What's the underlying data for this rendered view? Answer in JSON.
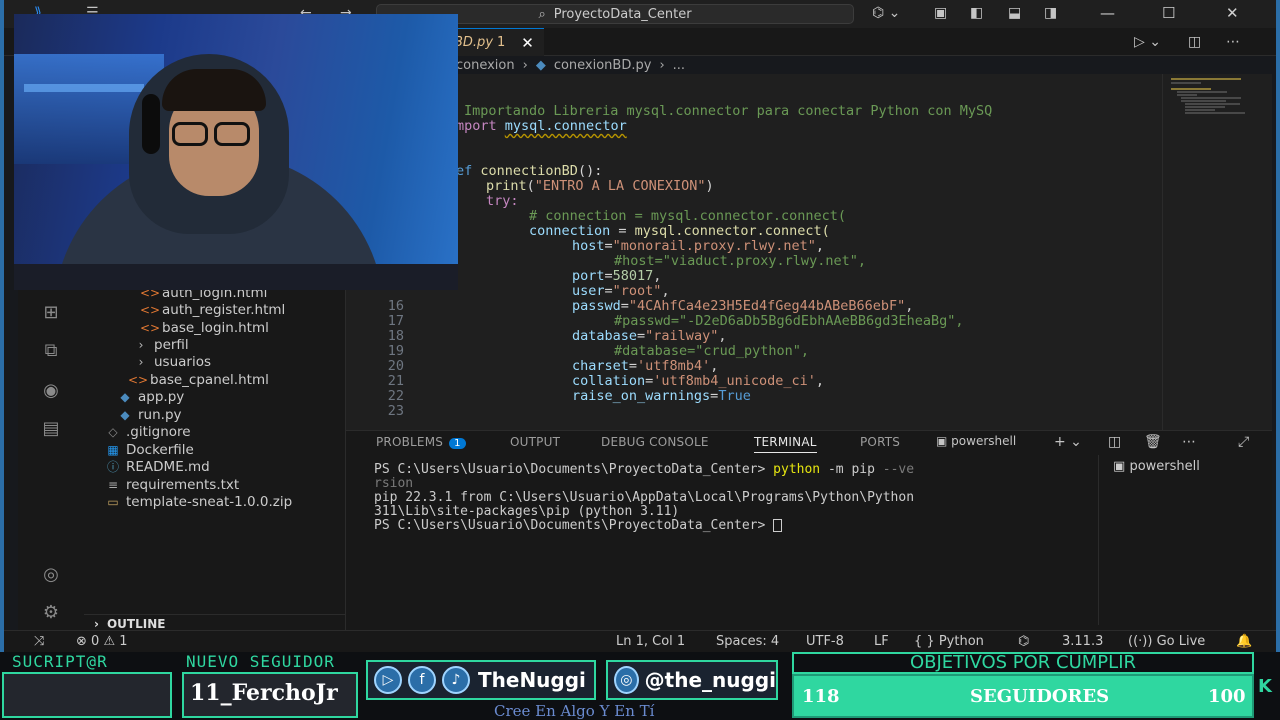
{
  "window": {
    "search_text": "ProyectoData_Center"
  },
  "tab": {
    "filename": "BD.py",
    "modified_count": "1",
    "close_glyph": "✕"
  },
  "breadcrumb": {
    "folder": "conexion",
    "file": "conexionBD.py",
    "more": "..."
  },
  "sidebar": {
    "items": [
      {
        "label": "auth_login.html",
        "icon": "html-icon"
      },
      {
        "label": "auth_register.html",
        "icon": "html-icon"
      },
      {
        "label": "base_login.html",
        "icon": "html-icon"
      },
      {
        "label": "perfil",
        "icon": "chevron-right-icon"
      },
      {
        "label": "usuarios",
        "icon": "chevron-right-icon"
      },
      {
        "label": "base_cpanel.html",
        "icon": "html-icon"
      },
      {
        "label": "app.py",
        "icon": "python-icon"
      },
      {
        "label": "run.py",
        "icon": "python-icon"
      },
      {
        "label": ".gitignore",
        "icon": "git-icon"
      },
      {
        "label": "Dockerfile",
        "icon": "docker-icon"
      },
      {
        "label": "README.md",
        "icon": "markdown-icon"
      },
      {
        "label": "requirements.txt",
        "icon": "text-file-icon"
      },
      {
        "label": "template-sneat-1.0.0.zip",
        "icon": "zip-icon"
      }
    ],
    "outline_label": "OUTLINE"
  },
  "editor": {
    "line_numbers": [
      "16",
      "17",
      "18",
      "19",
      "20",
      "21",
      "22",
      "23"
    ],
    "comment_import": "Importando Libreria mysql.connector para conectar Python con MySQ",
    "import_kw": "mport",
    "import_mod": "mysql.connector",
    "def_kw": "ef",
    "def_name": "connectionBD",
    "def_paren": "():",
    "print_fn": "print",
    "print_str": "\"ENTRO A LA CONEXION\"",
    "try_kw": "try:",
    "comment_connection": "# connection = mysql.connector.connect(",
    "conn_var": "connection",
    "conn_call": "mysql.connector.connect(",
    "host_key": "host",
    "host_val": "\"monorail.proxy.rlwy.net\"",
    "host_comment": "#host=\"viaduct.proxy.rlwy.net\",",
    "port_key": "port",
    "port_val": "58017",
    "user_key": "user",
    "user_val": "\"root\"",
    "passwd_key": "passwd",
    "passwd_val": "\"4CAhfCa4e23H5Ed4fGeg44bABeB66ebF\"",
    "passwd_comment": "#passwd=\"-D2eD6aDb5Bg6dEbhAAeBB6gd3EheaBg\",",
    "database_key": "database",
    "database_val": "\"railway\"",
    "database_comment": "#database=\"crud_python\",",
    "charset_key": "charset",
    "charset_val": "'utf8mb4'",
    "collation_key": "collation",
    "collation_val": "'utf8mb4_unicode_ci'",
    "raise_key": "raise_on_warnings",
    "raise_val": "True"
  },
  "panel": {
    "tabs": [
      "PROBLEMS",
      "OUTPUT",
      "DEBUG CONSOLE",
      "TERMINAL",
      "PORTS"
    ],
    "problems_count": "1",
    "active_tab": "TERMINAL",
    "shell_label": "powershell",
    "terminal": {
      "prompt1": "PS C:\\Users\\Usuario\\Documents\\ProyectoData_Center> ",
      "cmd1": "python",
      "args1": " -m pip ",
      "args1b": "--ve",
      "wrap1": "rsion",
      "output1": "pip 22.3.1 from C:\\Users\\Usuario\\AppData\\Local\\Programs\\Python\\Python",
      "output2": "311\\Lib\\site-packages\\pip (python 3.11)",
      "prompt2": "PS C:\\Users\\Usuario\\Documents\\ProyectoData_Center> "
    },
    "terminal_list_item": "powershell"
  },
  "statusbar": {
    "errors": "0",
    "warnings": "1",
    "position": "Ln 1, Col 1",
    "spaces": "Spaces: 4",
    "encoding": "UTF-8",
    "eol": "LF",
    "language": "Python",
    "python_version": "3.11.3",
    "go_live": "Go Live"
  },
  "overlay": {
    "subscriber_label": "SUCRIPT@R",
    "new_follower_label": "NUEVO SEGUIDOR",
    "new_follower_name": "11_FerchoJr",
    "social_primary": "TheNuggi",
    "social_secondary": "@the_nuggi",
    "slogan": "Cree En Algo Y En Tí",
    "goals_title": "OBJETIVOS POR CUMPLIR",
    "goal_current": "118",
    "goal_label": "SEGUIDORES",
    "goal_target": "100",
    "accent_color": "#2fd7a0"
  }
}
